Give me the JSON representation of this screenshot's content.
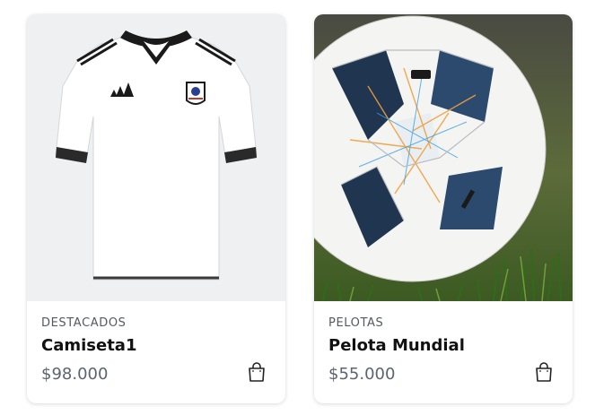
{
  "products": [
    {
      "category": "DESTACADOS",
      "name": "Camiseta1",
      "price": "$98.000",
      "image_alt": "camiseta-icon"
    },
    {
      "category": "PELOTAS",
      "name": "Pelota Mundial",
      "price": "$55.000",
      "image_alt": "soccer-ball-icon"
    }
  ],
  "colors": {
    "card_bg": "#ffffff",
    "category_text": "#555a60",
    "title_text": "#111111",
    "price_text": "#5b6470"
  }
}
